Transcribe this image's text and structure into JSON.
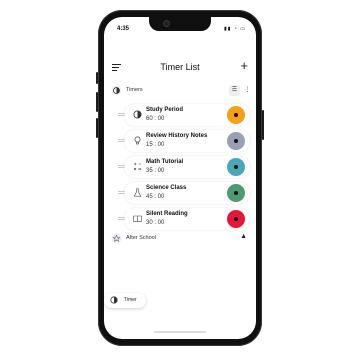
{
  "status_bar": {
    "time": "4:35",
    "signal": "▮▮ ◔ ▭"
  },
  "header": {
    "title": "Timer List",
    "add_label": "+"
  },
  "timers_section": {
    "label": "Timers"
  },
  "timers": [
    {
      "name": "Study Period",
      "time": "60 : 00",
      "color": "#f5a01a",
      "icon": "clock-half-icon"
    },
    {
      "name": "Review History Notes",
      "time": "15 : 00",
      "color": "#9aa0b3",
      "icon": "lightbulb-icon"
    },
    {
      "name": "Math Tutorial",
      "time": "35 : 00",
      "color": "#4aa7b8",
      "icon": "math-icon"
    },
    {
      "name": "Science Class",
      "time": "45 : 00",
      "color": "#4f9a72",
      "icon": "flask-icon"
    },
    {
      "name": "Silent Reading",
      "time": "30 : 00",
      "color": "#e2173b",
      "icon": "book-icon"
    }
  ],
  "after_school_section": {
    "label": "After School"
  },
  "fab": {
    "label": "Timer"
  }
}
